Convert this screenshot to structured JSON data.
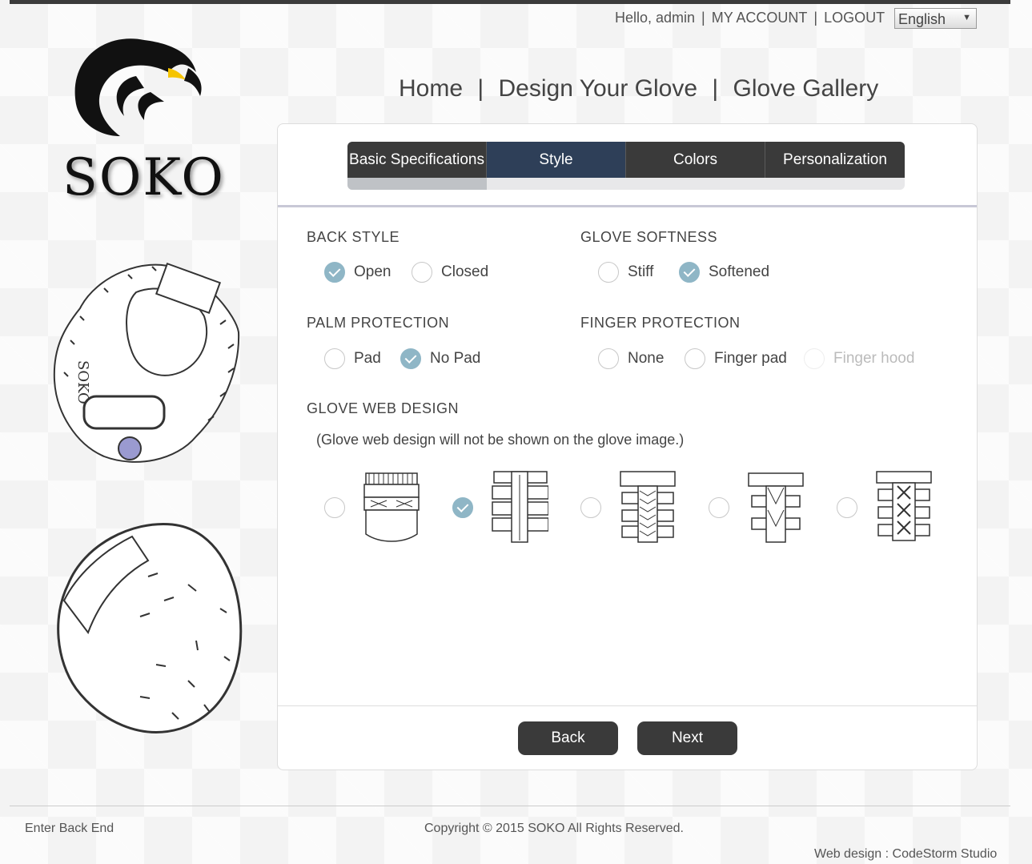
{
  "header": {
    "greeting": "Hello, admin",
    "my_account": "MY ACCOUNT",
    "logout": "LOGOUT",
    "language": "English"
  },
  "logo": {
    "text": "SOKO"
  },
  "nav": {
    "home": "Home",
    "design": "Design Your Glove",
    "gallery": "Glove Gallery"
  },
  "tabs": [
    "Basic Specifications",
    "Style",
    "Colors",
    "Personalization"
  ],
  "active_tab": "Style",
  "sections": {
    "back_style": {
      "title": "BACK STYLE",
      "options": [
        "Open",
        "Closed"
      ],
      "selected": "Open"
    },
    "glove_softness": {
      "title": "GLOVE SOFTNESS",
      "options": [
        "Stiff",
        "Softened"
      ],
      "selected": "Softened"
    },
    "palm_protection": {
      "title": "PALM PROTECTION",
      "options": [
        "Pad",
        "No Pad"
      ],
      "selected": "No Pad"
    },
    "finger_protection": {
      "title": "FINGER PROTECTION",
      "options": [
        "None",
        "Finger pad",
        "Finger hood"
      ],
      "selected": null,
      "disabled": [
        "Finger hood"
      ]
    },
    "web_design": {
      "title": "GLOVE WEB DESIGN",
      "note": "(Glove web design will not be shown on the glove image.)",
      "selected_index": 1,
      "count": 5
    }
  },
  "buttons": {
    "back": "Back",
    "next": "Next"
  },
  "footer": {
    "backend": "Enter Back End",
    "copyright": "Copyright © 2015 SOKO All Rights Reserved.",
    "credit": "Web design : CodeStorm Studio"
  },
  "colors": {
    "accent_check": "#8fb6c6",
    "active_tab": "#2e3f58",
    "tab": "#3a3a3a",
    "button": "#3a3a3a"
  }
}
